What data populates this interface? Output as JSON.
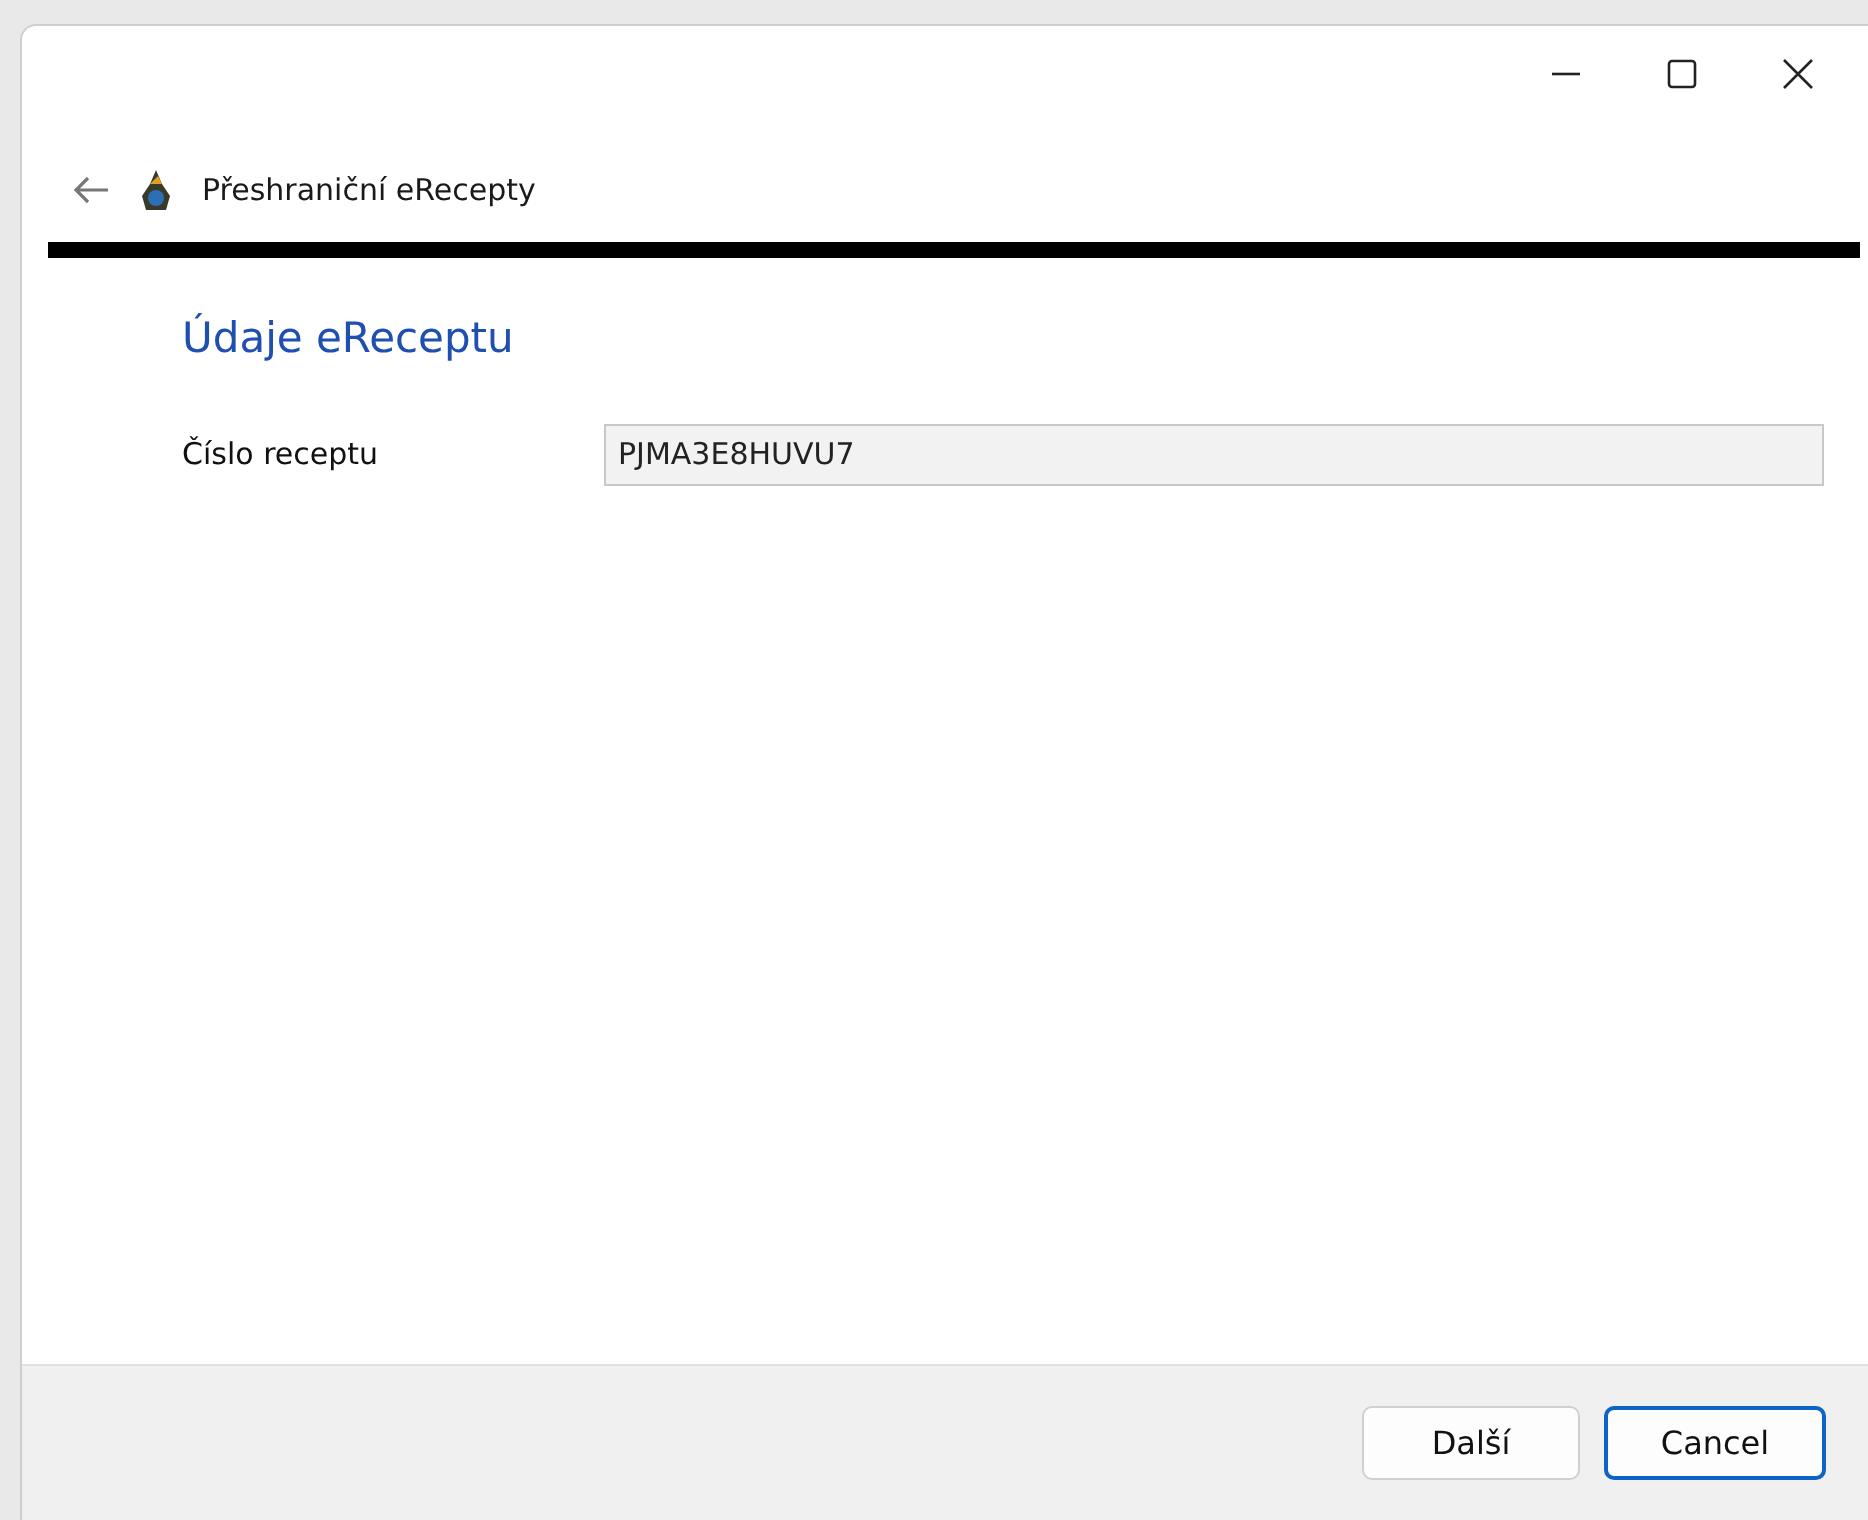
{
  "wizard": {
    "title": "Přeshraniční eRecepty"
  },
  "page": {
    "heading": "Údaje eReceptu",
    "fields": [
      {
        "label": "Číslo receptu",
        "value": "PJMA3E8HUVU7"
      }
    ]
  },
  "buttons": [
    {
      "label": "Další",
      "focused": false
    },
    {
      "label": "Cancel",
      "focused": true
    }
  ]
}
